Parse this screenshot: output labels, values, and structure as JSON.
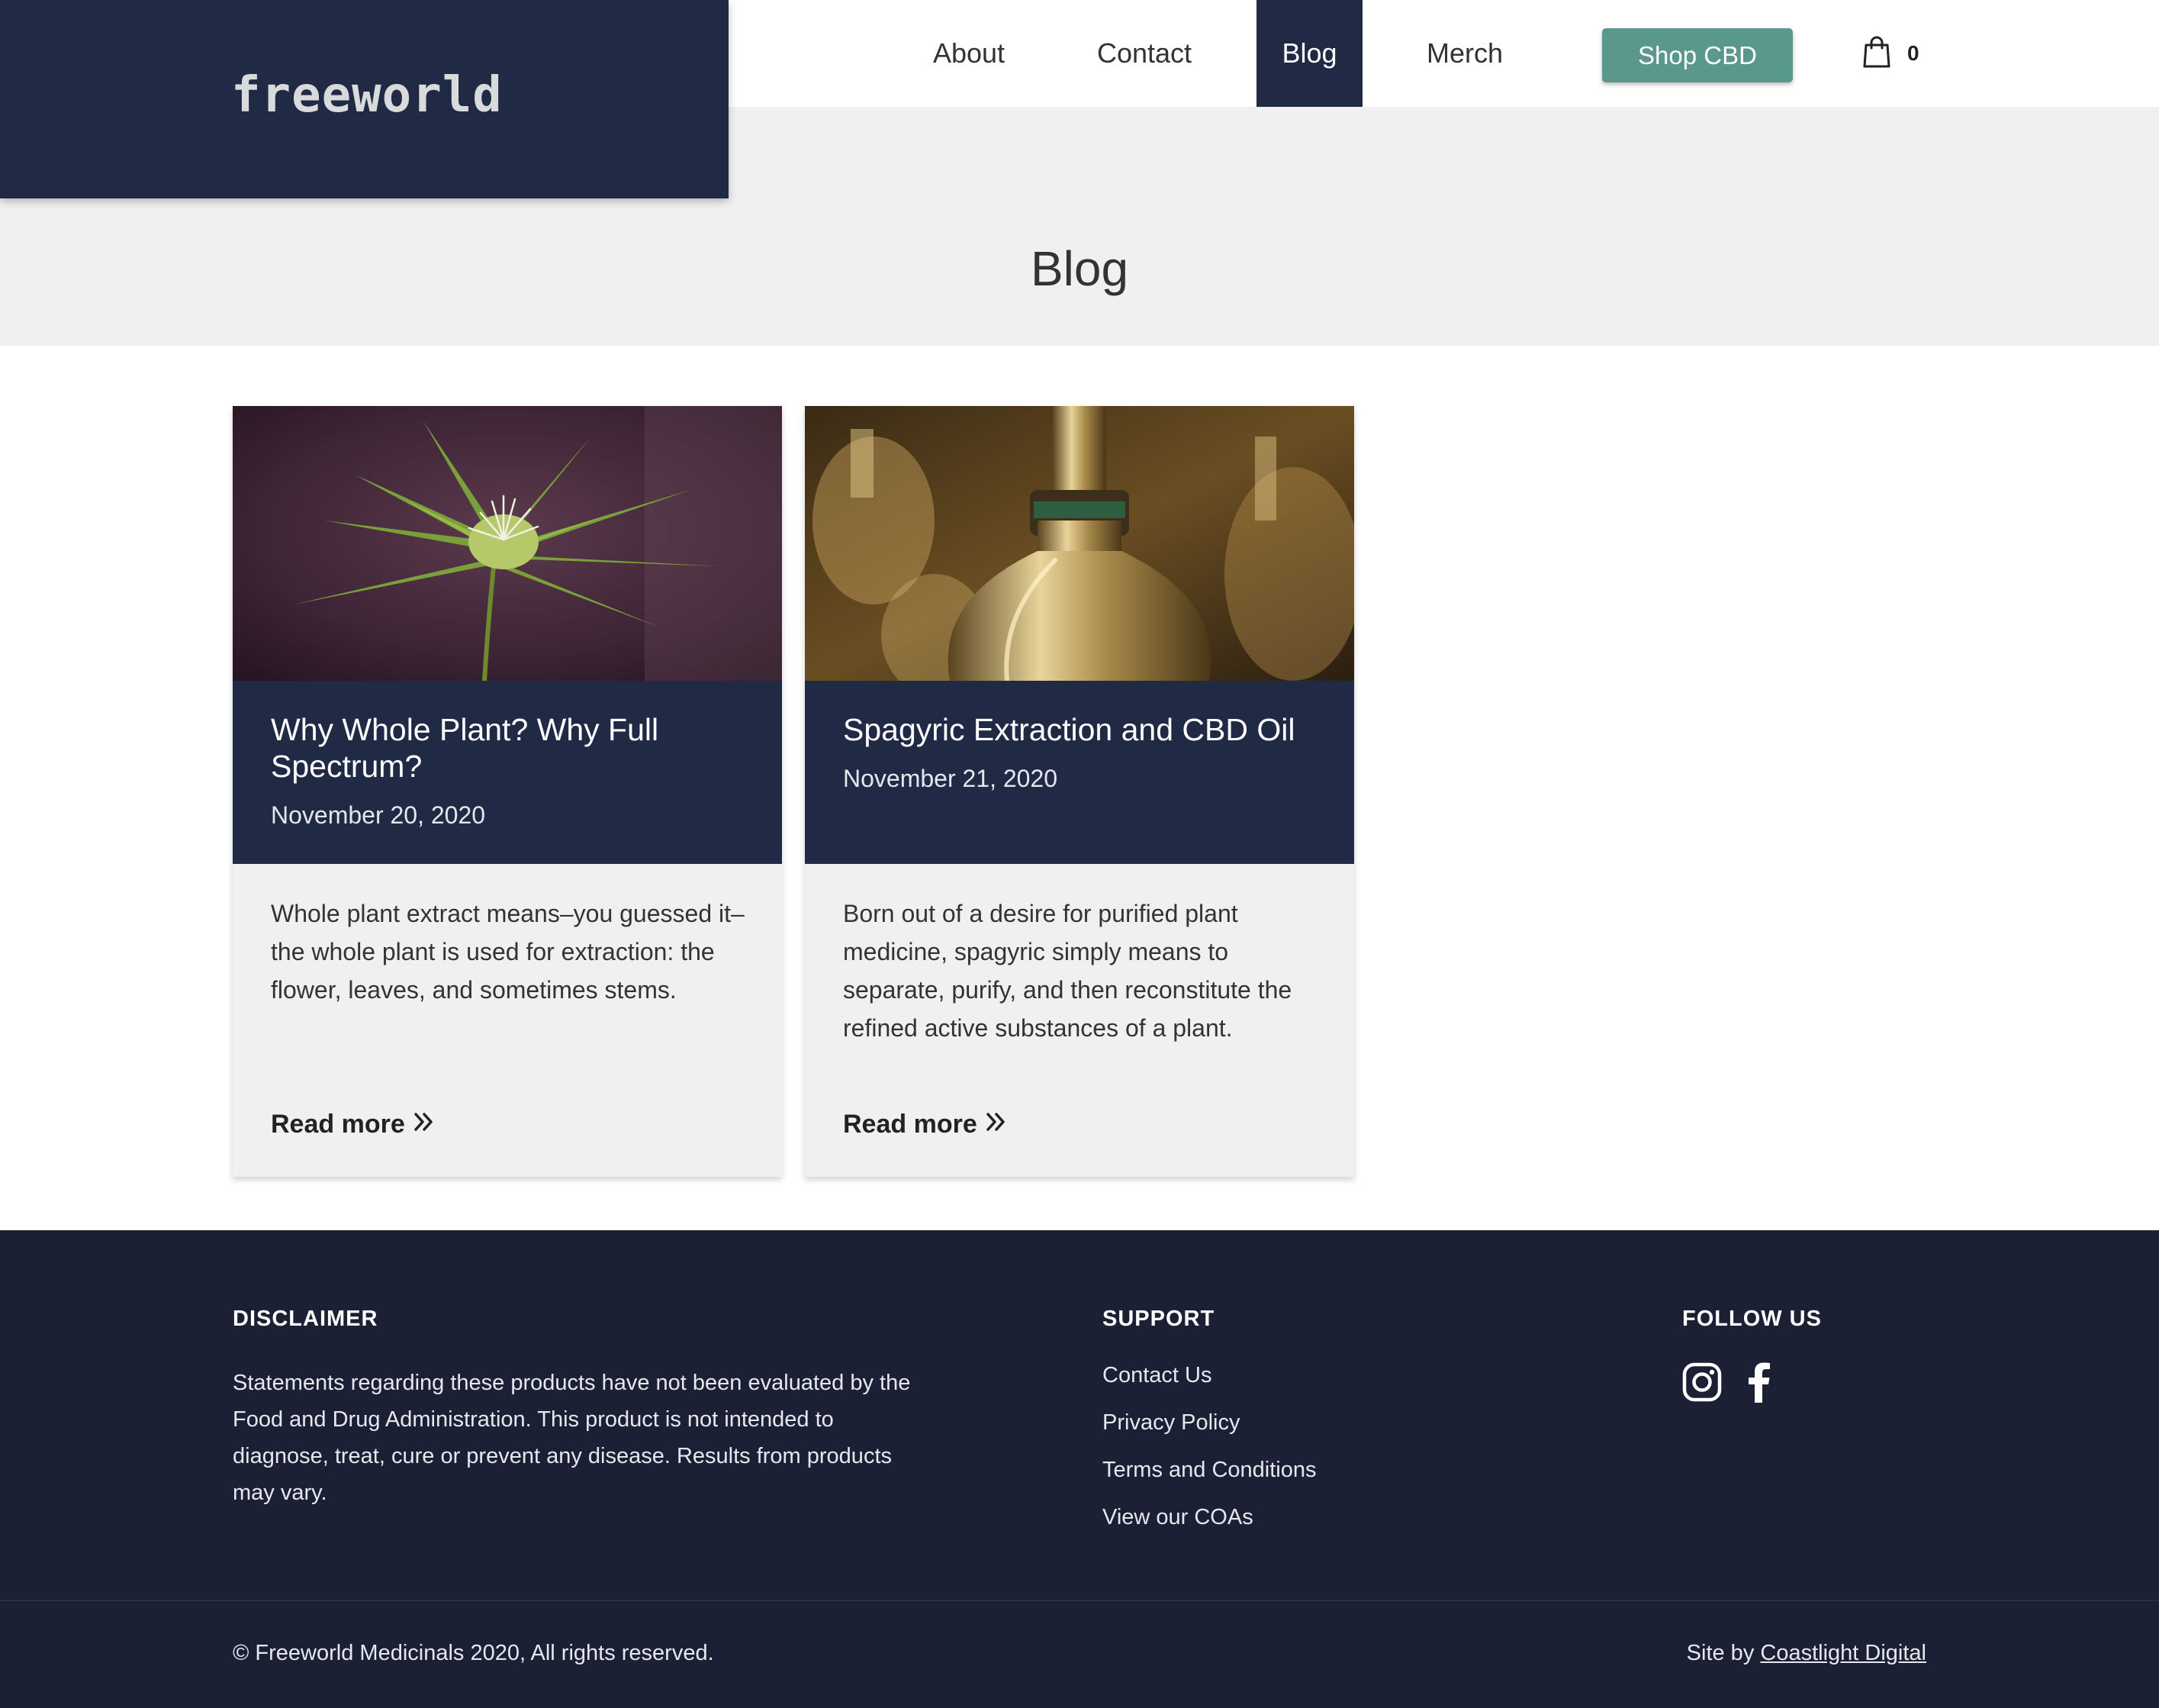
{
  "header": {
    "logo": "freeworld",
    "nav": {
      "about": "About",
      "contact": "Contact",
      "blog": "Blog",
      "merch": "Merch"
    },
    "shop_button": "Shop CBD",
    "cart_icon": "shopping-bag-icon",
    "cart_count": "0"
  },
  "hero": {
    "title": "Blog"
  },
  "posts": [
    {
      "title": "Why Whole Plant? Why Full Spectrum?",
      "date": "November 20, 2020",
      "excerpt": "Whole plant extract means–you guessed it–the whole plant is used for extraction: the flower, leaves, and sometimes stems.",
      "read_more": "Read more"
    },
    {
      "title": "Spagyric Extraction and CBD Oil",
      "date": "November 21, 2020",
      "excerpt": "Born out of a desire for purified plant medicine, spagyric simply means to separate, purify, and then reconstitute the refined active substances of a plant.",
      "read_more": "Read more"
    }
  ],
  "footer": {
    "disclaimer_heading": "DISCLAIMER",
    "disclaimer_text": "Statements regarding these products have not been evaluated by the Food and Drug Administration. This product is not intended to diagnose, treat, cure or prevent any disease. Results from products may vary.",
    "support_heading": "SUPPORT",
    "support_links": [
      "Contact Us",
      "Privacy Policy",
      "Terms and Conditions",
      "View our COAs"
    ],
    "follow_heading": "FOLLOW US",
    "social_icons": [
      "instagram-icon",
      "facebook-icon"
    ],
    "copyright": "© Freeworld Medicinals 2020, All rights reserved.",
    "site_by_prefix": "Site by",
    "site_by_link": "Coastlight Digital"
  },
  "colors": {
    "navy": "#212a44",
    "footer_navy": "#1b2034",
    "teal_button": "#5a978c",
    "light_gray": "#f0f0f0"
  }
}
